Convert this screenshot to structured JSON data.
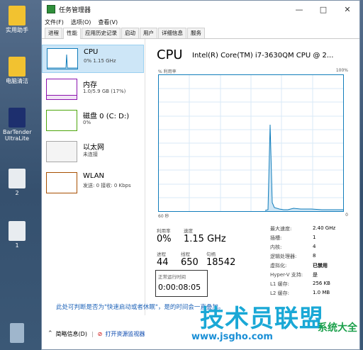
{
  "window": {
    "title": "任务管理器"
  },
  "menu": [
    "文件(F)",
    "选项(O)",
    "查看(V)"
  ],
  "tabs": [
    "进程",
    "性能",
    "应用历史记录",
    "启动",
    "用户",
    "详细信息",
    "服务"
  ],
  "active_tab": "性能",
  "desktop_icons": [
    {
      "label": "实用助手"
    },
    {
      "label": "电脑清洁"
    },
    {
      "label": "BarTender UltraLite"
    },
    {
      "label": "2"
    },
    {
      "label": "1"
    }
  ],
  "sidebar": [
    {
      "name": "CPU",
      "sub": "0% 1.15 GHz",
      "color": "#117dbb"
    },
    {
      "name": "内存",
      "sub": "1.0/5.9 GB (17%)",
      "color": "#8b12ae"
    },
    {
      "name": "磁盘 0 (C: D:)",
      "sub": "0%",
      "color": "#4da60c"
    },
    {
      "name": "以太网",
      "sub": "未连接",
      "color": "#a7a7a7"
    },
    {
      "name": "WLAN",
      "sub": "发送: 0 接收: 0 Kbps",
      "color": "#a74f01"
    }
  ],
  "cpu": {
    "heading": "CPU",
    "model": "Intel(R) Core(TM) i7-3630QM CPU @ 2...",
    "graph_label": "% 利用率",
    "graph_max": "100%",
    "x_left": "60 秒",
    "x_right": "0",
    "utilization_label": "利用率",
    "utilization": "0%",
    "speed_label": "速度",
    "speed": "1.15 GHz",
    "processes_label": "进程",
    "processes": "44",
    "threads_label": "线程",
    "threads": "650",
    "handles_label": "句柄",
    "handles": "18542",
    "uptime_label": "正常运行时间",
    "uptime": "0:00:08:05",
    "details": [
      {
        "k": "最大速度:",
        "v": "2.40 GHz"
      },
      {
        "k": "插槽:",
        "v": "1"
      },
      {
        "k": "内核:",
        "v": "4"
      },
      {
        "k": "逻辑处理器:",
        "v": "8"
      },
      {
        "k": "虚拟化:",
        "v": "已禁用"
      },
      {
        "k": "Hyper-V 支持:",
        "v": "是"
      },
      {
        "k": "L1 缓存:",
        "v": "256 KB"
      },
      {
        "k": "L2 缓存:",
        "v": "1.0 MB"
      }
    ]
  },
  "note": "此处可判断是否为\"快速启动或者休眠\"，是的时间会一直叠加。",
  "footer": {
    "less": "简略信息(D)",
    "open": "打开资源监视器"
  },
  "watermark": {
    "main": "技术员联盟",
    "url": "www.jsgho.com",
    "side": "系统大全"
  }
}
